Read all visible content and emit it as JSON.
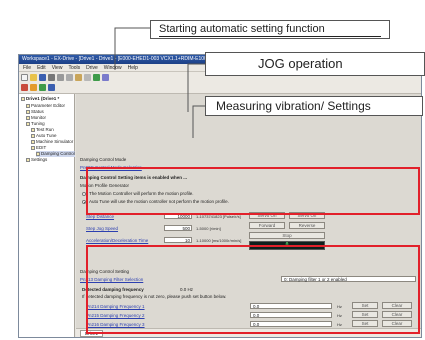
{
  "callouts": {
    "auto_setting": "Starting automatic setting function",
    "jog": "JOG operation",
    "vibration": "Measuring vibration/ Settings"
  },
  "window": {
    "title": "Workspace1 - EX-Drive - [Drive1 - Drive1 - [E000-EHED1-003 VCX1.1+RDIM-E100D01 Damping Control V]]",
    "menus": [
      "File",
      "Edit",
      "View",
      "Tools",
      "Drive",
      "Window",
      "Help"
    ]
  },
  "tree": {
    "root": "Drive1 (Drive1 *",
    "items": [
      "Parameter Editor",
      "Status",
      "Monitor",
      "Tuning",
      "Test Run",
      "Auto Tune",
      "Machine Simulator",
      "EDIT",
      "Damping Control",
      "Settings"
    ]
  },
  "panel": {
    "damping_mode_title": "Damping Control Mode",
    "damping_mode_link": "Pn00C Control Mode Selection",
    "auto_setting_heading": "Damping Control Setting items is enabled when ...",
    "motion_profile": "Motion Profile Generator",
    "radio1": "The Motion Controller will perform the motion profile.",
    "radio2": "Auto Tune will use the motion controller not perform the motion profile.",
    "rows": [
      {
        "label": "Step Distance",
        "value": "10000",
        "unit": "1-1073741823 [Pulse/r/s]"
      },
      {
        "label": "Step Jog Speed",
        "value": "500",
        "unit": "1-5000 [r/min]"
      },
      {
        "label": "Acceleration/Deceleration Time",
        "value": "10",
        "unit": "1-10000 [ms/1000r/min/s]"
      }
    ],
    "buttons": {
      "servo_on": "Servo On",
      "servo_off": "Servo Off",
      "forward": "Forward",
      "reverse": "Reverse",
      "stop": "Stop"
    },
    "display_value": "0",
    "damping_setting_title": "Damping Control Setting",
    "filter_link": "Pn213 Damping Filter Selection",
    "filter_value": "0: Damping filter 1 or 2 enabled",
    "detected_label": "Detected damping frequency",
    "detected_value": "0.0 Hz",
    "detected_note": "If detected damping frequency is not zero, please push set button below.",
    "freq_rows": [
      {
        "label": "Pn214 Damping Frequency 1",
        "value": "0.0",
        "unit": "Hz",
        "set": "Set",
        "clear": "Clear"
      },
      {
        "label": "Pn215 Damping Frequency 2",
        "value": "0.0",
        "unit": "Hz",
        "set": "Set",
        "clear": "Clear"
      },
      {
        "label": "Pn216 Damping Frequency 3",
        "value": "0.0",
        "unit": "Hz",
        "set": "Set",
        "clear": "Clear"
      },
      {
        "label": "Pn217 Damping Frequency 4",
        "value": "0.0",
        "unit": "Hz",
        "set": "Set",
        "clear": "Clear"
      }
    ],
    "tab": "Drive1"
  },
  "colors": {
    "highlight": "#e2202a",
    "link": "#2c3fb0",
    "display": "#6cff7a"
  }
}
